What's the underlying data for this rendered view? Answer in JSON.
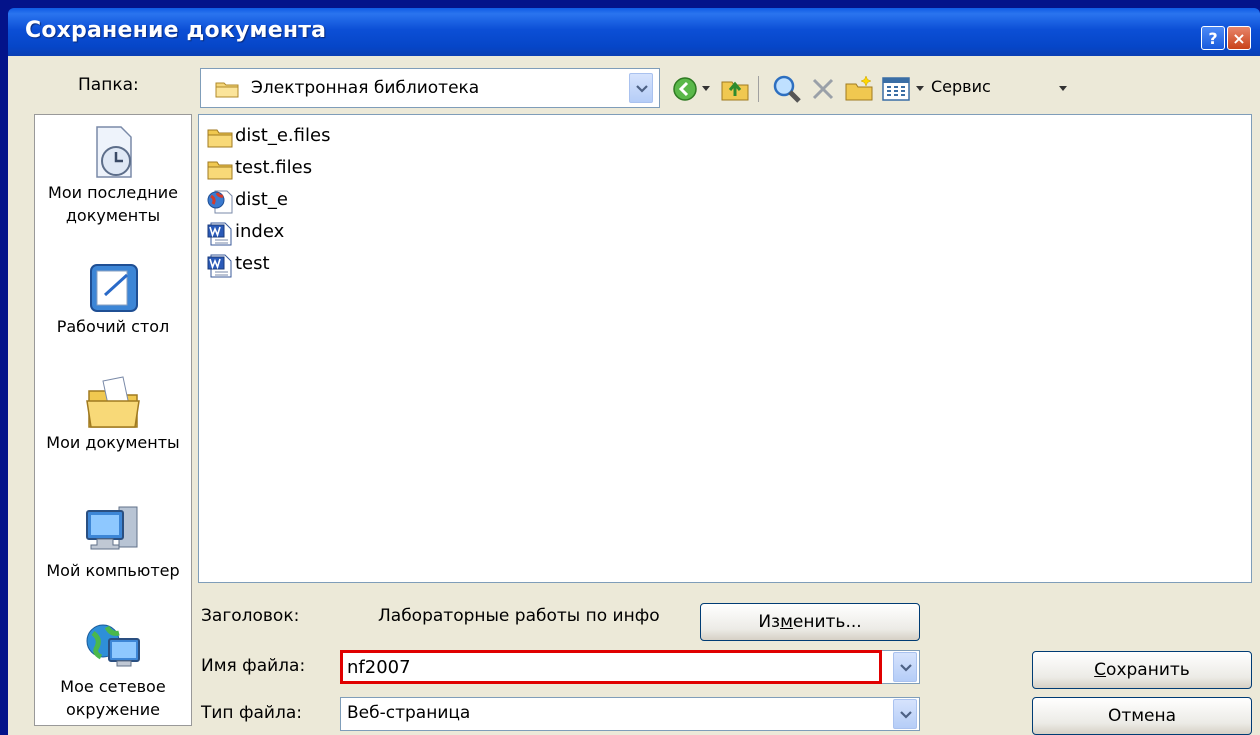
{
  "window": {
    "title": "Сохранение документа",
    "help": "?",
    "close": "×"
  },
  "folder": {
    "label": "Папка:",
    "current": "Электронная библиотека"
  },
  "toolbar": {
    "service": "Сервис"
  },
  "places": [
    {
      "label": "Мои последние документы"
    },
    {
      "label": "Рабочий стол"
    },
    {
      "label": "Мои документы"
    },
    {
      "label": "Мой компьютер"
    },
    {
      "label": "Мое сетевое окружение"
    }
  ],
  "files": [
    {
      "name": "dist_e.files",
      "icon": "folder-icon"
    },
    {
      "name": "test.files",
      "icon": "folder-icon"
    },
    {
      "name": "dist_e",
      "icon": "web-document-icon"
    },
    {
      "name": "index",
      "icon": "word-document-icon"
    },
    {
      "name": "test",
      "icon": "word-document-icon"
    }
  ],
  "form": {
    "title_label": "Заголовок:",
    "title_value": "Лабораторные работы по инфо",
    "change_button_pre": "Из",
    "change_button_mnemonic": "м",
    "change_button_post": "енить...",
    "filename_label": "Имя файла:",
    "filename_value": "nf2007",
    "filetype_label": "Тип файла:",
    "filetype_value": "Веб-страница"
  },
  "buttons": {
    "save_mnemonic": "С",
    "save_rest": "охранить",
    "cancel": "Отмена"
  },
  "colors": {
    "highlight": "#e00000",
    "titlebar": "#0c4fd6",
    "dialog_bg": "#ece9d8"
  }
}
